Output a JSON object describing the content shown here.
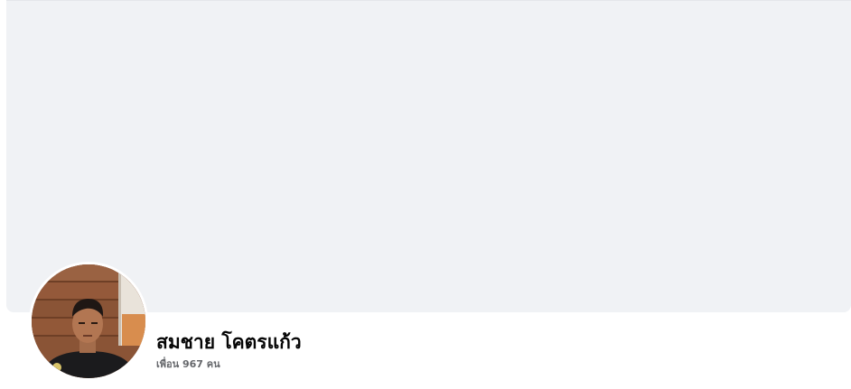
{
  "profile": {
    "name": "สมชาย โคตรแก้ว",
    "friends_text": "เพื่อน 967 คน"
  },
  "colors": {
    "cover_background": "#f0f2f5",
    "name_text": "#050505",
    "secondary_text": "#65676b"
  },
  "icons": {
    "avatar": "profile-photo"
  }
}
